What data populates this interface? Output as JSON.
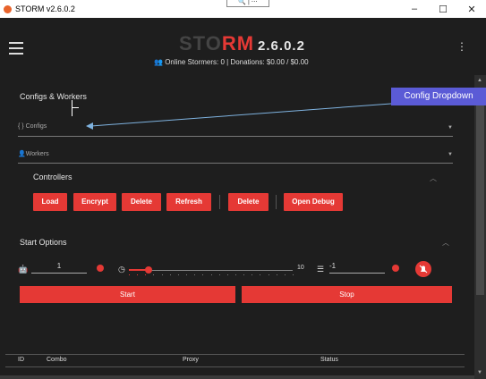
{
  "window": {
    "title": "STORM v2.6.0.2",
    "minimize": "–",
    "maximize": "☐",
    "close": "✕",
    "search_tab": "🔍 | ⋯"
  },
  "header": {
    "logo_main": "STO",
    "logo_accent": "RM",
    "version": "2.6.0.2",
    "stats": "Online Stormers: 0 | Donations: $0.00 / $0.00"
  },
  "configs_section": {
    "title": "Configs & Workers",
    "configs_placeholder": "{ } Configs",
    "workers_placeholder": "Workers"
  },
  "annotation": {
    "callout": "Config Dropdown"
  },
  "controllers": {
    "title": "Controllers",
    "buttons": [
      "Load",
      "Encrypt",
      "Delete",
      "Refresh",
      "Delete",
      "Open Debug"
    ]
  },
  "start_options": {
    "title": "Start Options",
    "threads_value": "1",
    "slider_max": "10",
    "slider_level": 0.12,
    "retry_value": "-1",
    "start_label": "Start",
    "stop_label": "Stop"
  },
  "table": {
    "columns": [
      "ID",
      "Combo",
      "Proxy",
      "Status"
    ]
  },
  "colors": {
    "accent": "#e53935",
    "callout": "#5b5bd6",
    "background": "#1e1e1e"
  },
  "icons": {
    "app": "storm-app-icon",
    "menu": "hamburger-icon",
    "more": "kebab-icon",
    "users": "users-icon",
    "threads": "bot-icon",
    "timer": "timer-icon",
    "retry": "list-icon",
    "mute": "bell-off-icon"
  }
}
